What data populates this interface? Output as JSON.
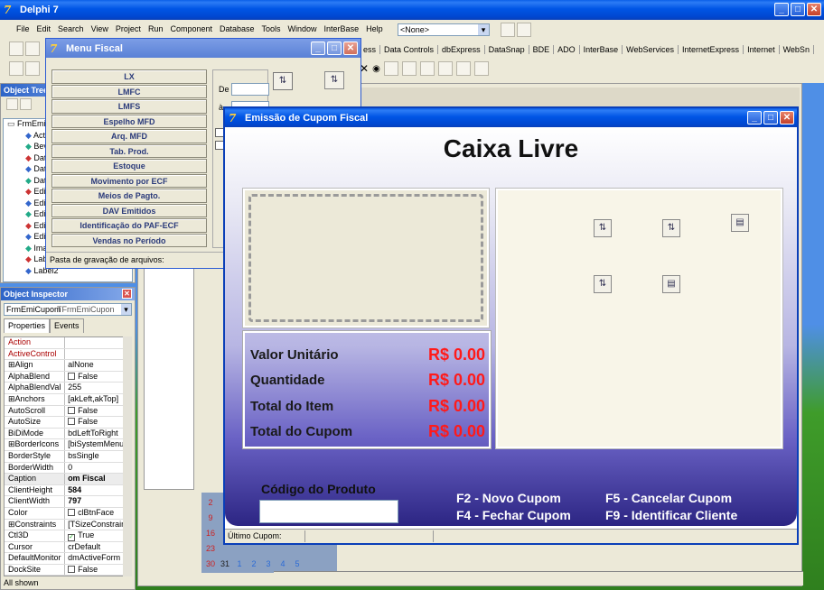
{
  "ide": {
    "title": "Delphi 7",
    "menu": [
      "File",
      "Edit",
      "Search",
      "View",
      "Project",
      "Run",
      "Component",
      "Database",
      "Tools",
      "Window",
      "InterBase",
      "Help"
    ],
    "combo_value": "<None>",
    "palette_tabs": [
      "ess",
      "Data Controls",
      "dbExpress",
      "DataSnap",
      "BDE",
      "ADO",
      "InterBase",
      "WebServices",
      "InternetExpress",
      "Internet",
      "WebSn"
    ]
  },
  "tree": {
    "title": "Object Tree",
    "items": [
      "FrmEmi",
      "Acti",
      "Bev",
      "Dat",
      "Dat",
      "Dat",
      "Edi",
      "Edi",
      "Edi",
      "Edi",
      "Edi",
      "Ima",
      "Lab",
      "Label2"
    ]
  },
  "inspector": {
    "title": "Object Inspector",
    "object": "FrmEmiCupom",
    "object_type": "TFrmEmiCupon",
    "tabs": [
      "Properties",
      "Events"
    ],
    "rows": [
      {
        "k": "Action",
        "v": "",
        "red": true
      },
      {
        "k": "ActiveControl",
        "v": "",
        "red": true
      },
      {
        "k": "Align",
        "v": "alNone",
        "prefix": "⊞"
      },
      {
        "k": "AlphaBlend",
        "v": "False",
        "check": true
      },
      {
        "k": "AlphaBlendVal",
        "v": "255"
      },
      {
        "k": "Anchors",
        "v": "[akLeft,akTop]",
        "prefix": "⊞"
      },
      {
        "k": "AutoScroll",
        "v": "False",
        "check": true
      },
      {
        "k": "AutoSize",
        "v": "False",
        "check": true
      },
      {
        "k": "BiDiMode",
        "v": "bdLeftToRight"
      },
      {
        "k": "BorderIcons",
        "v": "[biSystemMenu]",
        "prefix": "⊞"
      },
      {
        "k": "BorderStyle",
        "v": "bsSingle"
      },
      {
        "k": "BorderWidth",
        "v": "0"
      },
      {
        "k": "Caption",
        "v": "om Fiscal",
        "bold": true
      },
      {
        "k": "ClientHeight",
        "v": "584",
        "bold": true
      },
      {
        "k": "ClientWidth",
        "v": "797",
        "bold": true
      },
      {
        "k": "Color",
        "v": "clBtnFace",
        "check": true
      },
      {
        "k": "Constraints",
        "v": "[TSizeConstrain",
        "prefix": "⊞"
      },
      {
        "k": "Ctl3D",
        "v": "True",
        "checked": true
      },
      {
        "k": "Cursor",
        "v": "crDefault"
      },
      {
        "k": "DefaultMonitor",
        "v": "dmActiveForm"
      },
      {
        "k": "DockSite",
        "v": "False",
        "check": true
      }
    ],
    "status": "All shown"
  },
  "menu_fiscal": {
    "title": "Menu Fiscal",
    "buttons": [
      "LX",
      "LMFC",
      "LMFS",
      "Espelho MFD",
      "Arq. MFD",
      "Tab. Prod.",
      "Estoque",
      "Movimento por ECF",
      "Meios de Pagto.",
      "DAV Emitidos",
      "Identificação do PAF-ECF",
      "Vendas no Período"
    ],
    "de_label": "De",
    "a_label": "à",
    "status": "Pasta de gravação de arquivos:"
  },
  "calendar": {
    "rows": [
      [
        "2",
        "",
        "",
        "",
        "",
        "",
        ""
      ],
      [
        "9",
        "",
        "",
        "",
        "",
        "",
        ""
      ],
      [
        "16",
        "",
        "",
        "",
        "",
        "",
        ""
      ],
      [
        "23",
        "",
        "",
        "",
        "",
        "",
        ""
      ],
      [
        "30",
        "31",
        "1",
        "2",
        "3",
        "4",
        "5"
      ]
    ]
  },
  "cupom": {
    "title": "Emissão de Cupom Fiscal",
    "header": "Caixa Livre",
    "fields": [
      {
        "label": "Valor Unitário",
        "value": "R$ 0.00"
      },
      {
        "label": "Quantidade",
        "value": "R$ 0.00"
      },
      {
        "label": "Total do Item",
        "value": "R$ 0.00"
      },
      {
        "label": "Total do Cupom",
        "value": "R$ 0.00"
      }
    ],
    "codigo_label": "Código do Produto",
    "codigo_value": "",
    "shortcuts": [
      "F2 - Novo Cupom",
      "F5 - Cancelar Cupom",
      "F4 - Fechar Cupom",
      "F9 - Identificar Cliente"
    ],
    "status": "Último Cupom:"
  },
  "colors": {
    "accent": "#0055e5",
    "value_red": "#ff1a1a",
    "face": "#ece9d8"
  }
}
